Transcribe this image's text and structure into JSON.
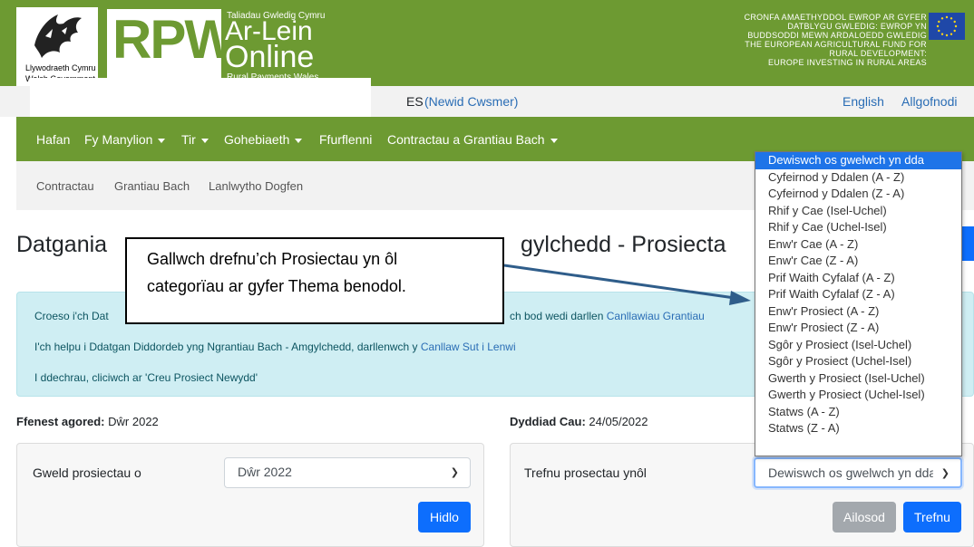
{
  "header": {
    "gov_logo_line1": "Llywodraeth Cymru",
    "gov_logo_line2": "Welsh Government",
    "rpw": "RPW",
    "tagline": "Taliadau Gwledig Cymru",
    "product_line1": "Ar-Lein",
    "product_line2": "Online",
    "subtitle": "Rural Payments Wales",
    "eu_lines": [
      "CRONFA AMAETHYDDOL EWROP AR GYFER",
      "DATBLYGU GWLEDIG: EWROP YN",
      "BUDDSODDI MEWN ARDALOEDD GWLEDIG",
      "THE EUROPEAN AGRICULTURAL FUND FOR",
      "RURAL DEVELOPMENT:",
      "EUROPE INVESTING IN RURAL AREAS"
    ],
    "eu_flag_icon": "eu-flag-icon"
  },
  "customer_bar": {
    "name_fragment": "ES",
    "change_link": "(Newid Cwsmer)",
    "english_link": "English",
    "logout_link": "Allgofnodi"
  },
  "nav": {
    "items": [
      "Hafan",
      "Fy Manylion",
      "Tir",
      "Gohebiaeth",
      "Ffurflenni",
      "Contractau a Grantiau Bach"
    ]
  },
  "subnav": {
    "items": [
      "Contractau",
      "Grantiau Bach",
      "Lanlwytho Dogfen"
    ]
  },
  "page": {
    "title_left": "Datgania",
    "title_right": "gylchedd - Prosiecta"
  },
  "callout": {
    "line1": "Gallwch drefnu’ch Prosiectau yn ôl",
    "line2": "categorïau ar gyfer Thema benodol."
  },
  "info": {
    "line1_start": "Croeso i'ch Dat",
    "line1_end": "ch bod wedi darllen",
    "line1_link": "Canllawiau Grantiau",
    "line2_text": "I'ch helpu i Ddatgan Diddordeb yng Ngrantiau Bach - Amgylchedd, darllenwch y",
    "line2_link": "Canllaw Sut i Lenwi",
    "line3": "I ddechrau, cliciwch ar 'Creu Prosiect Newydd'"
  },
  "window": {
    "open_label": "Ffenest agored:",
    "open_value": "Dŵr 2022",
    "close_label": "Dyddiad Cau:",
    "close_value": "24/05/2022"
  },
  "filter": {
    "view_label": "Gweld prosiectau o",
    "view_value": "Dŵr 2022",
    "filter_button": "Hidlo"
  },
  "sort": {
    "sort_label": "Trefnu prosectau ynôl",
    "sort_value": "Dewiswch os gwelwch yn dda",
    "reset_button": "Ailosod",
    "sort_button": "Trefnu",
    "options": [
      "Dewiswch os gwelwch yn dda",
      "Cyfeirnod y Ddalen (A - Z)",
      "Cyfeirnod y Ddalen (Z - A)",
      "Rhif y Cae (Isel-Uchel)",
      "Rhif y Cae (Uchel-Isel)",
      "Enw'r Cae (A - Z)",
      "Enw'r Cae (Z - A)",
      "Prif Waith Cyfalaf (A - Z)",
      "Prif Waith Cyfalaf (Z - A)",
      "Enw'r Prosiect (A - Z)",
      "Enw'r Prosiect (Z - A)",
      "Sgôr y Prosiect (Isel-Uchel)",
      "Sgôr y Prosiect (Uchel-Isel)",
      "Gwerth y Prosiect (Isel-Uchel)",
      "Gwerth y Prosiect (Uchel-Isel)",
      "Statws (A - Z)",
      "Statws (Z - A)"
    ]
  },
  "colors": {
    "brand_green": "#6d9a32",
    "link_blue": "#2a6db5",
    "button_blue": "#0d6efd",
    "info_bg": "#cfeef3",
    "arrow": "#2f5d8a"
  }
}
